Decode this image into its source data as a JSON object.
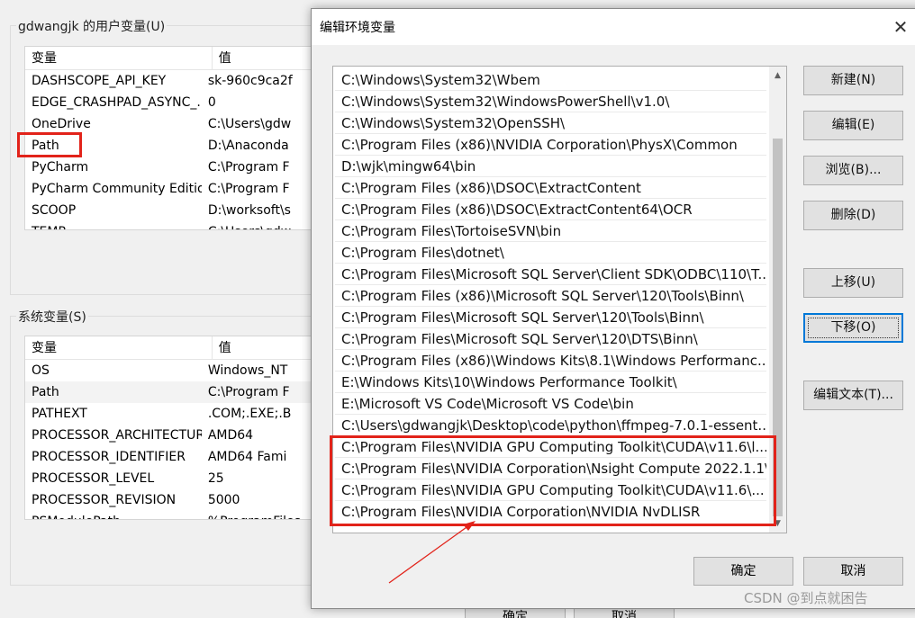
{
  "user_vars": {
    "group_title": "gdwangjk 的用户变量(U)",
    "col_name": "变量",
    "col_value": "值",
    "rows": [
      {
        "name": "DASHSCOPE_API_KEY",
        "value": "sk-960c9ca2f"
      },
      {
        "name": "EDGE_CRASHPAD_ASYNC_...",
        "value": "0"
      },
      {
        "name": "OneDrive",
        "value": "C:\\Users\\gdw"
      },
      {
        "name": "Path",
        "value": "D:\\Anaconda"
      },
      {
        "name": "PyCharm",
        "value": "C:\\Program F"
      },
      {
        "name": "PyCharm Community Edition",
        "value": "C:\\Program F"
      },
      {
        "name": "SCOOP",
        "value": "D:\\worksoft\\s"
      },
      {
        "name": "TEMP",
        "value": "C:\\Users\\gdw"
      }
    ]
  },
  "system_vars": {
    "group_title": "系统变量(S)",
    "col_name": "变量",
    "col_value": "值",
    "rows": [
      {
        "name": "OS",
        "value": "Windows_NT"
      },
      {
        "name": "Path",
        "value": "C:\\Program F"
      },
      {
        "name": "PATHEXT",
        "value": ".COM;.EXE;.B"
      },
      {
        "name": "PROCESSOR_ARCHITECTURE",
        "value": "AMD64"
      },
      {
        "name": "PROCESSOR_IDENTIFIER",
        "value": "AMD64 Fami"
      },
      {
        "name": "PROCESSOR_LEVEL",
        "value": "25"
      },
      {
        "name": "PROCESSOR_REVISION",
        "value": "5000"
      },
      {
        "name": "PSModulePath",
        "value": "%ProgramFiles"
      }
    ]
  },
  "bg_buttons": {
    "ok": "确定",
    "cancel": "取消"
  },
  "dialog": {
    "title": "编辑环境变量",
    "close_glyph": "✕",
    "path_entries": [
      "C:\\Windows\\System32\\Wbem",
      "C:\\Windows\\System32\\WindowsPowerShell\\v1.0\\",
      "C:\\Windows\\System32\\OpenSSH\\",
      "C:\\Program Files (x86)\\NVIDIA Corporation\\PhysX\\Common",
      "D:\\wjk\\mingw64\\bin",
      "C:\\Program Files (x86)\\DSOC\\ExtractContent",
      "C:\\Program Files (x86)\\DSOC\\ExtractContent64\\OCR",
      "C:\\Program Files\\TortoiseSVN\\bin",
      "C:\\Program Files\\dotnet\\",
      "C:\\Program Files\\Microsoft SQL Server\\Client SDK\\ODBC\\110\\T...",
      "C:\\Program Files (x86)\\Microsoft SQL Server\\120\\Tools\\Binn\\",
      "C:\\Program Files\\Microsoft SQL Server\\120\\Tools\\Binn\\",
      "C:\\Program Files\\Microsoft SQL Server\\120\\DTS\\Binn\\",
      "C:\\Program Files (x86)\\Windows Kits\\8.1\\Windows Performanc...",
      "E:\\Windows Kits\\10\\Windows Performance Toolkit\\",
      "E:\\Microsoft VS Code\\Microsoft VS Code\\bin",
      "C:\\Users\\gdwangjk\\Desktop\\code\\python\\ffmpeg-7.0.1-essent...",
      "C:\\Program Files\\NVIDIA GPU Computing Toolkit\\CUDA\\v11.6\\l...",
      "C:\\Program Files\\NVIDIA Corporation\\Nsight Compute 2022.1.1\\",
      "C:\\Program Files\\NVIDIA GPU Computing Toolkit\\CUDA\\v11.6\\...",
      "C:\\Program Files\\NVIDIA Corporation\\NVIDIA NvDLISR"
    ],
    "buttons": {
      "new": "新建(N)",
      "edit": "编辑(E)",
      "browse": "浏览(B)...",
      "delete": "删除(D)",
      "move_up": "上移(U)",
      "move_down": "下移(O)",
      "edit_text": "编辑文本(T)...",
      "ok": "确定",
      "cancel": "取消"
    }
  },
  "watermark": "CSDN @到点就困告",
  "colors": {
    "highlight_box": "#e2231a",
    "focus_border": "#0078d7"
  }
}
